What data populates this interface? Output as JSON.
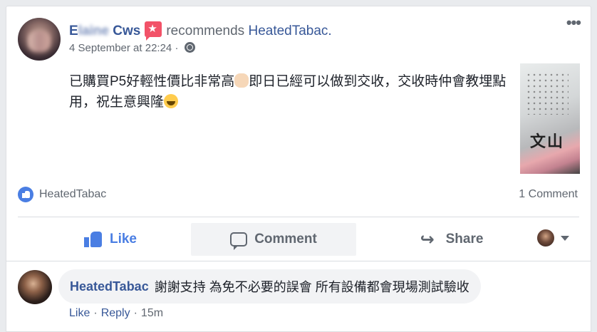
{
  "post": {
    "author_first": "E",
    "author_blurred": "laine",
    "author_last": "Cws",
    "verb": "recommends",
    "page_name": "HeatedTabac.",
    "timestamp": "4 September at 22:24",
    "meta_sep": "·",
    "text_part1": "已購買P5好輕性價比非常高",
    "text_part2": "即日已經可以做到交收，交收時仲會教埋點用，祝生意興隆",
    "photo_text": "文山",
    "likers": "HeatedTabac",
    "comment_count": "1 Comment"
  },
  "actions": {
    "like": "Like",
    "comment": "Comment",
    "share": "Share"
  },
  "comment": {
    "author": "HeatedTabac",
    "text": "謝謝支持 為免不必要的誤會 所有設備都會現場測試驗收",
    "like": "Like",
    "reply": "Reply",
    "sep": "·",
    "age": "15m"
  },
  "colors": {
    "link": "#385898",
    "like_blue": "#4a7ee3",
    "recommend_red": "#f25268",
    "muted": "#606770"
  },
  "icons": [
    "recommend-icon",
    "globe-icon",
    "more-icon",
    "like-bubble-icon",
    "thumb-icon",
    "comment-bubble-icon",
    "share-icon",
    "caret-down-icon"
  ]
}
